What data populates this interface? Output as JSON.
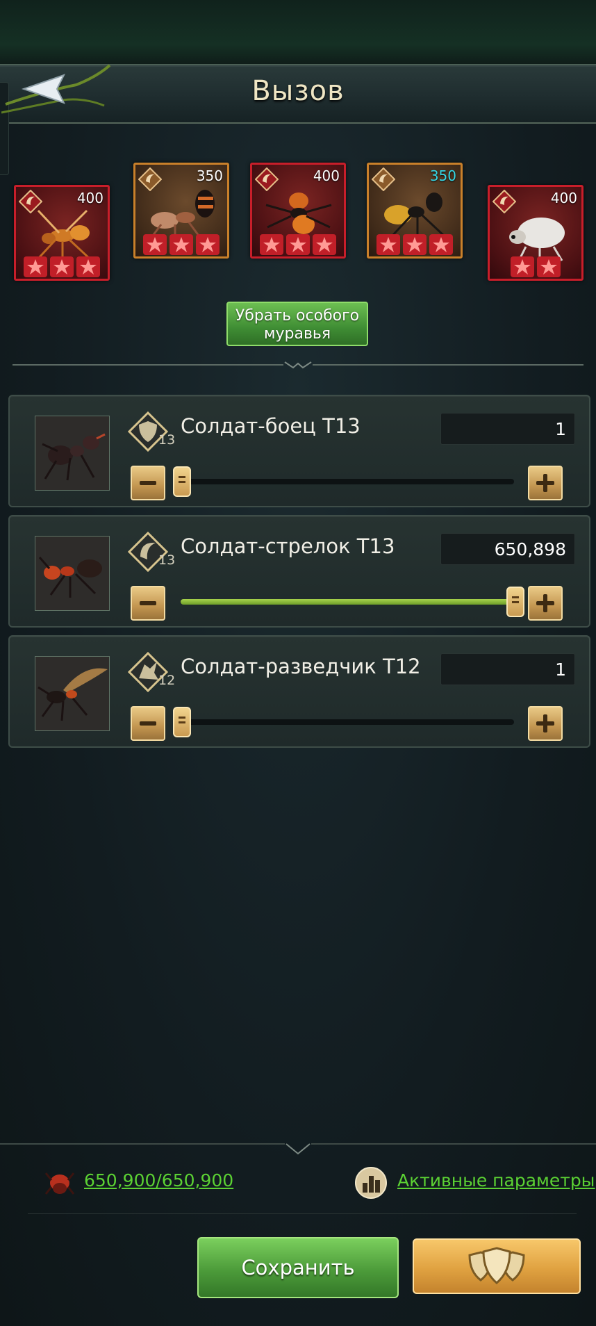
{
  "header": {
    "title": "Вызов"
  },
  "special_ants": [
    {
      "value": "400",
      "rarity": "red",
      "stars": 3
    },
    {
      "value": "350",
      "rarity": "gold",
      "stars": 3
    },
    {
      "value": "400",
      "rarity": "red",
      "stars": 3
    },
    {
      "value": "350",
      "rarity": "gold",
      "stars": 3,
      "value_color": "#36d7e6"
    },
    {
      "value": "400",
      "rarity": "red",
      "stars": 2
    }
  ],
  "remove_button": {
    "label_line1": "Убрать особого",
    "label_line2": "муравья"
  },
  "troops": [
    {
      "name": "Солдат-боец T13",
      "tier": "13",
      "count": "1",
      "slider_fraction": 0.0,
      "type_icon": "shield-type-icon"
    },
    {
      "name": "Солдат-стрелок T13",
      "tier": "13",
      "count": "650,898",
      "slider_fraction": 1.0,
      "type_icon": "shooter-type-icon"
    },
    {
      "name": "Солдат-разведчик T12",
      "tier": "12",
      "count": "1",
      "slider_fraction": 0.0,
      "type_icon": "scout-type-icon"
    }
  ],
  "footer": {
    "capacity": "650,900/650,900",
    "params_label": "Активные параметры",
    "save_label": "Сохранить"
  },
  "colors": {
    "accent_green": "#5bd133",
    "red_frame": "#c81e2a",
    "gold_frame": "#c9802a"
  }
}
